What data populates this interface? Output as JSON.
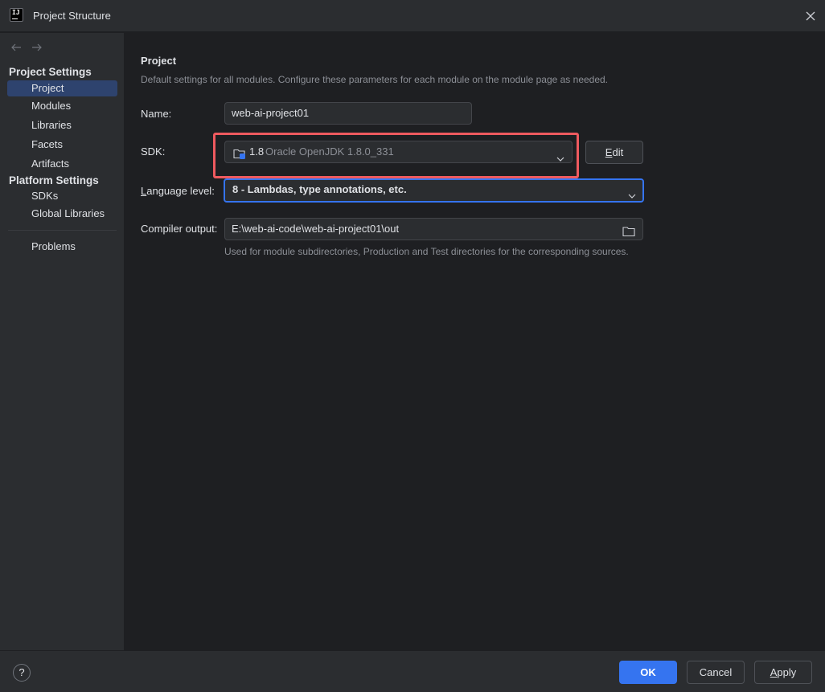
{
  "window": {
    "title": "Project Structure",
    "logo_text": "IJ"
  },
  "sidebar": {
    "sections": [
      {
        "header": "Project Settings",
        "items": [
          {
            "label": "Project",
            "selected": true
          },
          {
            "label": "Modules",
            "selected": false
          },
          {
            "label": "Libraries",
            "selected": false
          },
          {
            "label": "Facets",
            "selected": false
          },
          {
            "label": "Artifacts",
            "selected": false
          }
        ]
      },
      {
        "header": "Platform Settings",
        "items": [
          {
            "label": "SDKs",
            "selected": false
          },
          {
            "label": "Global Libraries",
            "selected": false
          }
        ]
      }
    ],
    "problems_label": "Problems"
  },
  "main": {
    "title": "Project",
    "description": "Default settings for all modules. Configure these parameters for each module on the module page as needed.",
    "name_label": "Name:",
    "name_value": "web-ai-project01",
    "sdk_label": "SDK:",
    "sdk_version": "1.8",
    "sdk_name": "Oracle OpenJDK 1.8.0_331",
    "edit_label_mnemonic": "E",
    "edit_label_rest": "dit",
    "language_label_mnemonic": "L",
    "language_label_rest": "anguage level:",
    "language_value": "8 - Lambdas, type annotations, etc.",
    "compiler_label": "Compiler output:",
    "compiler_value": "E:\\web-ai-code\\web-ai-project01\\out",
    "compiler_hint": "Used for module subdirectories, Production and Test directories for the corresponding sources."
  },
  "footer": {
    "help_label": "?",
    "ok_label": "OK",
    "cancel_label": "Cancel",
    "apply_label_mnemonic": "A",
    "apply_label_rest": "pply"
  },
  "colors": {
    "background": "#1e1f22",
    "panel": "#2b2d30",
    "accent": "#3574f0",
    "selection": "#2e436e",
    "highlight_annotation": "#ef5a5f"
  }
}
